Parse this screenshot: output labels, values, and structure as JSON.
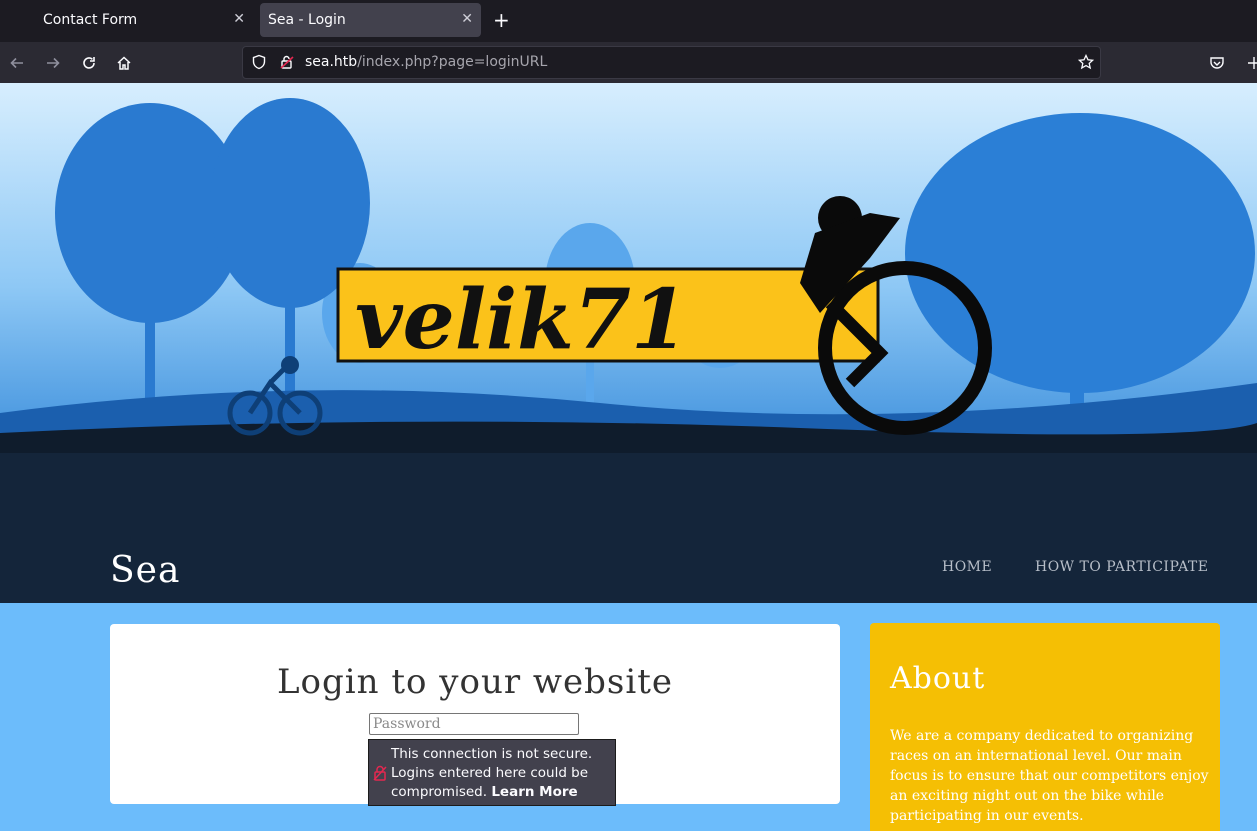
{
  "browser": {
    "tabs": [
      {
        "title": "Contact Form",
        "active": false
      },
      {
        "title": "Sea - Login",
        "active": true
      }
    ],
    "url_host": "sea.htb",
    "url_path": "/index.php?page=loginURL"
  },
  "hero": {
    "logo_text": "velik71",
    "colors": {
      "sky": "#9fd4fb",
      "trees": "#1f6fc4",
      "logo_box": "#fbc21a",
      "ground": "#0f1c2c"
    }
  },
  "site": {
    "title": "Sea",
    "menu": [
      {
        "label": "HOME"
      },
      {
        "label": "HOW TO PARTICIPATE"
      }
    ]
  },
  "login": {
    "heading": "Login to your website",
    "password_placeholder": "Password"
  },
  "insecure_warning": {
    "text": "This connection is not secure. Logins entered here could be compromised.",
    "link": "Learn More"
  },
  "about": {
    "title": "About",
    "text": "We are a company dedicated to organizing races on an international level. Our main focus is to ensure that our competitors enjoy an exciting night out on the bike while participating in our events."
  },
  "colors": {
    "page_bg": "#6cbcfb",
    "about_bg": "#f5bf04",
    "header_bg": "#14253a"
  }
}
